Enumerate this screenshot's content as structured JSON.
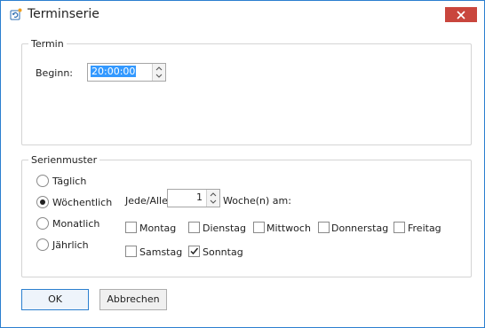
{
  "window": {
    "title": "Terminserie",
    "accent": "#2b7fcf",
    "close_color": "#c9463d"
  },
  "termin": {
    "group_label": "Termin",
    "beginn_label": "Beginn:",
    "beginn_value": "20:00:00"
  },
  "serienmuster": {
    "group_label": "Serienmuster",
    "radios": [
      {
        "label": "Täglich",
        "checked": false
      },
      {
        "label": "Wöchentlich",
        "checked": true
      },
      {
        "label": "Monatlich",
        "checked": false
      },
      {
        "label": "Jährlich",
        "checked": false
      }
    ],
    "jede_label": "Jede/Alle",
    "interval_value": "1",
    "woche_label": "Woche(n) am:",
    "days": [
      {
        "label": "Montag",
        "checked": false
      },
      {
        "label": "Dienstag",
        "checked": false
      },
      {
        "label": "Mittwoch",
        "checked": false
      },
      {
        "label": "Donnerstag",
        "checked": false
      },
      {
        "label": "Freitag",
        "checked": false
      },
      {
        "label": "Samstag",
        "checked": false
      },
      {
        "label": "Sonntag",
        "checked": true
      }
    ]
  },
  "buttons": {
    "ok": "OK",
    "cancel": "Abbrechen"
  },
  "icons": {
    "app": "recurrence-icon",
    "close": "close-icon",
    "spin_up": "chevron-up-icon",
    "spin_down": "chevron-down-icon",
    "check": "checkmark-icon"
  }
}
